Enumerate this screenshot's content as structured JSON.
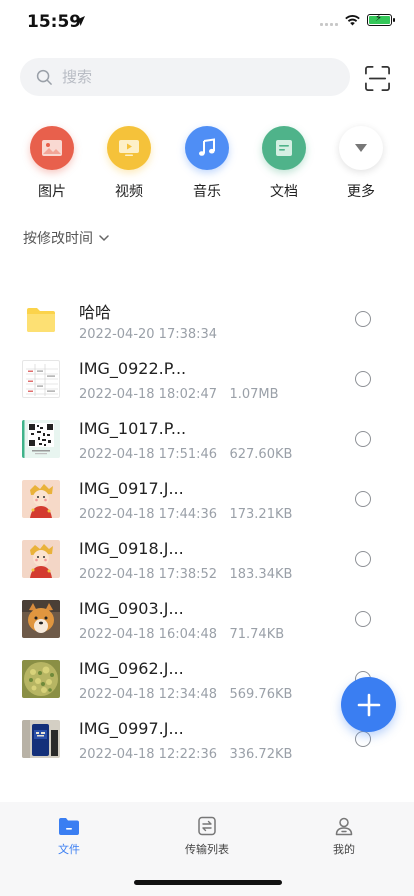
{
  "status_bar": {
    "time": "15:59"
  },
  "search": {
    "placeholder": "搜索"
  },
  "categories": [
    {
      "label": "图片",
      "icon": "image-icon",
      "color": "#e8604c"
    },
    {
      "label": "视频",
      "icon": "video-icon",
      "color": "#f5c23a"
    },
    {
      "label": "音乐",
      "icon": "music-icon",
      "color": "#4f8ef5"
    },
    {
      "label": "文档",
      "icon": "document-icon",
      "color": "#4fb38a"
    },
    {
      "label": "更多",
      "icon": "chevron-down-icon",
      "color": "#ffffff"
    }
  ],
  "sort": {
    "label": "按修改时间"
  },
  "files": [
    {
      "name": "哈哈",
      "date": "2022-04-20 17:38:34",
      "size": "",
      "type": "folder"
    },
    {
      "name": "IMG_0922.P...",
      "date": "2022-04-18 18:02:47",
      "size": "1.07MB",
      "type": "table"
    },
    {
      "name": "IMG_1017.P...",
      "date": "2022-04-18 17:51:46",
      "size": "627.60KB",
      "type": "qr"
    },
    {
      "name": "IMG_0917.J...",
      "date": "2022-04-18 17:44:36",
      "size": "173.21KB",
      "type": "cartoon"
    },
    {
      "name": "IMG_0918.J...",
      "date": "2022-04-18 17:38:52",
      "size": "183.34KB",
      "type": "cartoon"
    },
    {
      "name": "IMG_0903.J...",
      "date": "2022-04-18 16:04:48",
      "size": "71.74KB",
      "type": "dog"
    },
    {
      "name": "IMG_0962.J...",
      "date": "2022-04-18 12:34:48",
      "size": "569.76KB",
      "type": "food"
    },
    {
      "name": "IMG_0997.J...",
      "date": "2022-04-18 12:22:36",
      "size": "336.72KB",
      "type": "bottle"
    }
  ],
  "tabs": [
    {
      "label": "文件",
      "icon": "folder-icon",
      "active": true
    },
    {
      "label": "传输列表",
      "icon": "transfer-list-icon",
      "active": false
    },
    {
      "label": "我的",
      "icon": "profile-icon",
      "active": false
    }
  ],
  "colors": {
    "accent": "#3a7ef2",
    "meta_text": "#9aa0a8",
    "search_bg": "#f2f3f5"
  }
}
